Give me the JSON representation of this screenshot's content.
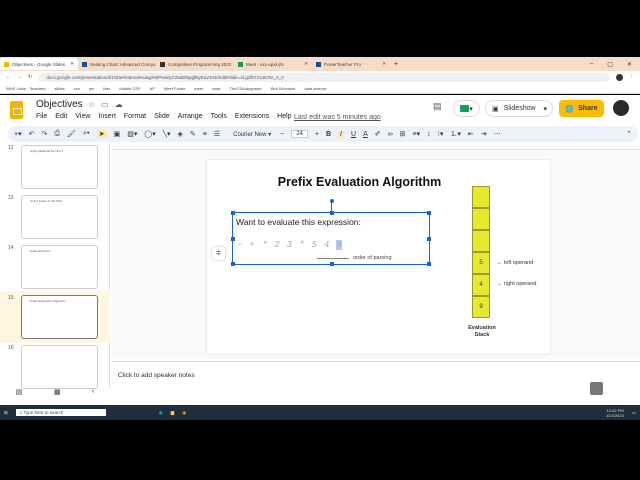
{
  "browser": {
    "tabs": [
      {
        "label": "Objectives - Google Slides",
        "active": true
      },
      {
        "label": "Seating Chart: Advanced Compu"
      },
      {
        "label": "Competitive Programming 2022"
      },
      {
        "label": "Meet - xxx-apxk-jtv"
      },
      {
        "label": "PowerTeacher Pro"
      }
    ],
    "url": "docs.google.com/presentation/d/1O0eNNamulenuagXWPveelyCZwB0bpgfByEaVS4E/edit#slide=id.g1fb7214576c_0_0",
    "bookmarks": [
      "WHS Links - Teachers",
      "slides",
      "ccs",
      "rpx",
      "Nav",
      "Mobile CSP",
      "AP",
      "Meet Folder",
      "meet",
      "csab",
      "TheCSAutograder",
      "Bell Schedule",
      "data science"
    ]
  },
  "app": {
    "title": "Objectives",
    "menus": [
      "File",
      "Edit",
      "View",
      "Insert",
      "Format",
      "Slide",
      "Arrange",
      "Tools",
      "Extensions",
      "Help"
    ],
    "last_edit": "Last edit was 5 minutes ago",
    "slideshow_label": "Slideshow",
    "share_label": "Share",
    "font": "Courier New",
    "font_size": "24",
    "accent": "#fbbc04"
  },
  "filmstrip": {
    "slides": [
      {
        "num": "12",
        "title": "String Methods for Unit 2"
      },
      {
        "num": "13",
        "title": "Unit 2 Topics in AP CSA"
      },
      {
        "num": "14",
        "title": "Data structures"
      },
      {
        "num": "15",
        "title": "Prefix Evaluation Algorithm",
        "selected": true
      },
      {
        "num": "16",
        "title": ""
      }
    ]
  },
  "slide": {
    "title": "Prefix Evaluation Algorithm",
    "prompt": "Want to evaluate this expression:",
    "tokens": [
      "−",
      "+",
      "*",
      "2",
      "3",
      "*",
      "5",
      "4",
      "9"
    ],
    "parse_label": "order of parsing",
    "stack": [
      "",
      "",
      "",
      "5",
      "4",
      "9"
    ],
    "left_label": "← left operand",
    "right_label": "← right operand",
    "stack_caption_1": "Evaluation",
    "stack_caption_2": "Stack",
    "stack_color": "#e6e832"
  },
  "notes_placeholder": "Click to add speaker notes",
  "taskbar": {
    "search": "Type here to search",
    "time": "12:42 PM",
    "date": "1/23/2023"
  }
}
